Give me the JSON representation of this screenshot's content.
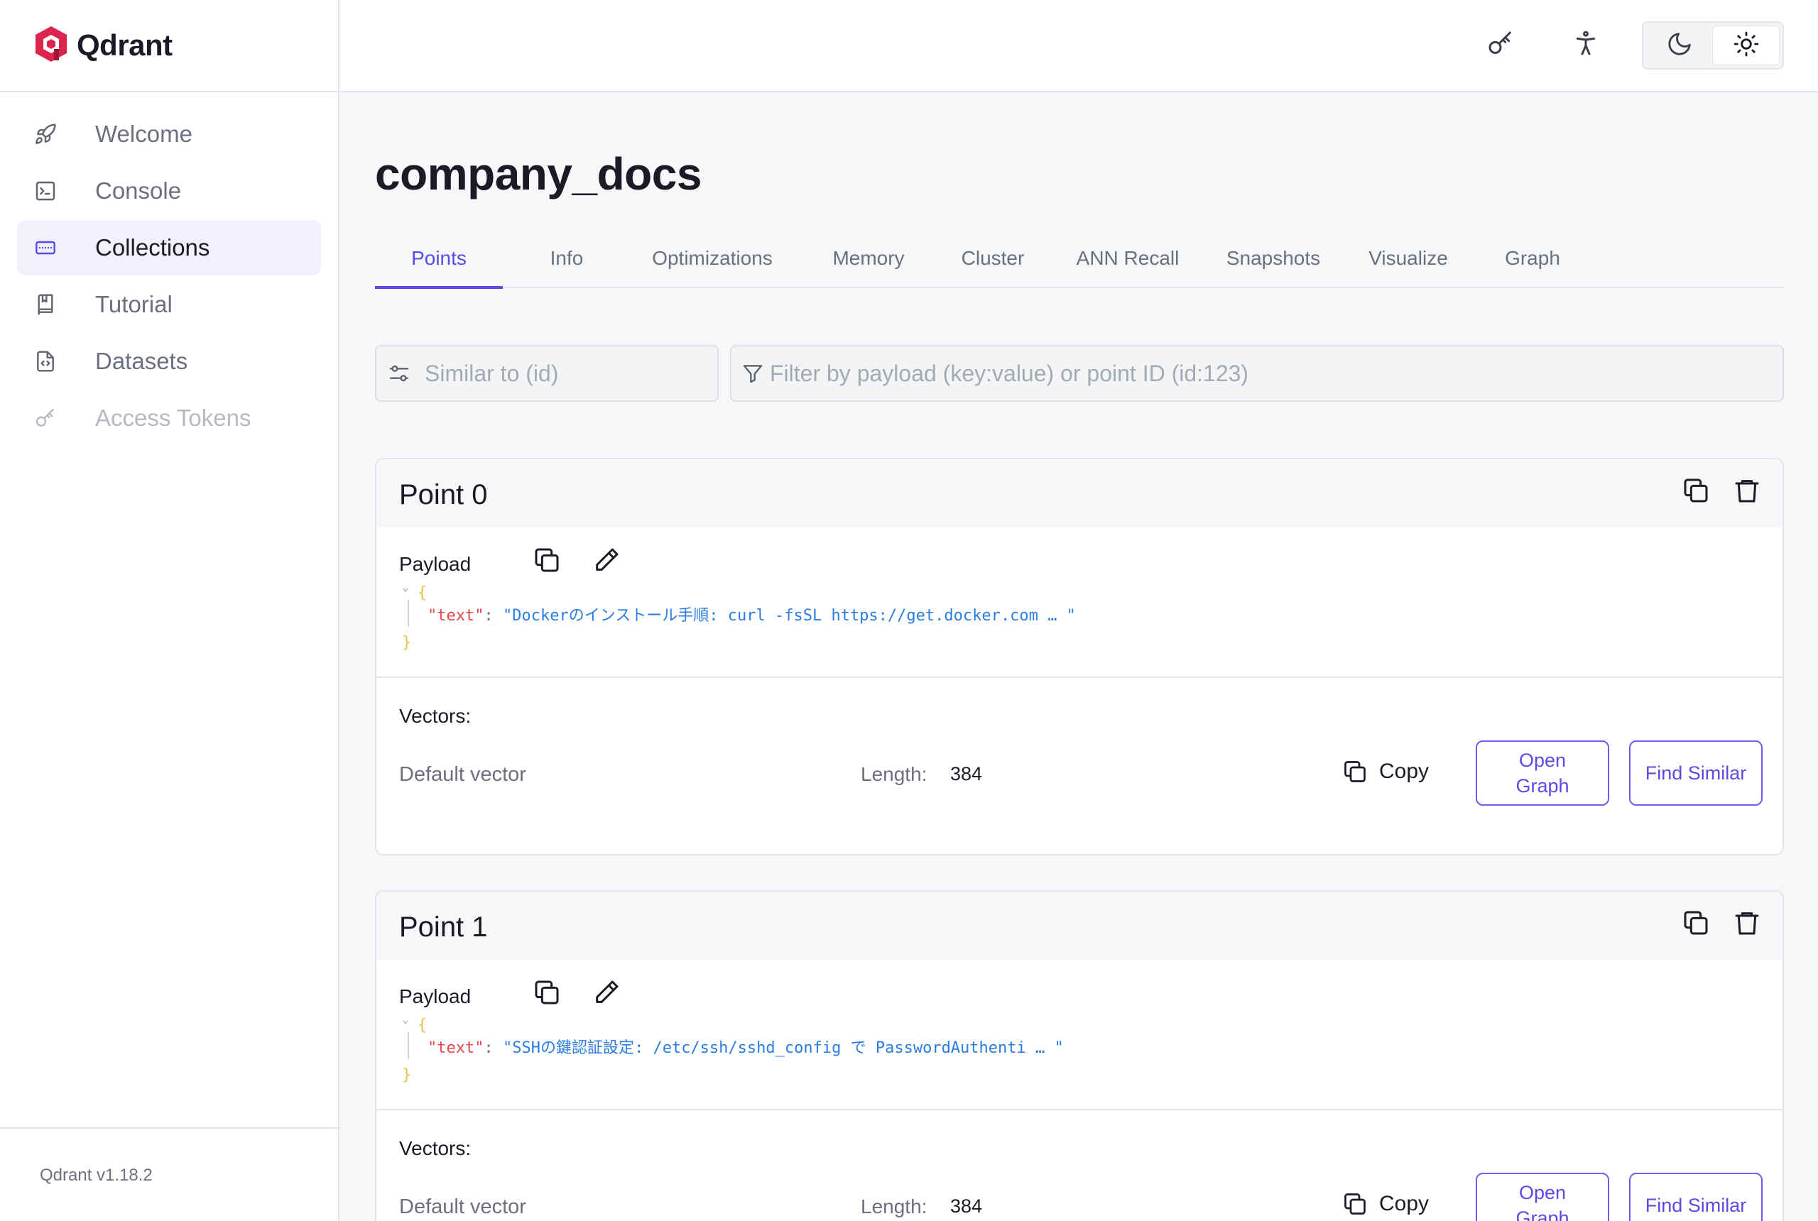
{
  "app": {
    "name": "Qdrant",
    "version": "Qdrant v1.18.2"
  },
  "sidebar": {
    "items": [
      {
        "label": "Welcome",
        "icon": "rocket-icon"
      },
      {
        "label": "Console",
        "icon": "terminal-icon"
      },
      {
        "label": "Collections",
        "icon": "collection-icon",
        "active": true
      },
      {
        "label": "Tutorial",
        "icon": "book-icon"
      },
      {
        "label": "Datasets",
        "icon": "file-code-icon"
      },
      {
        "label": "Access Tokens",
        "icon": "key-icon",
        "disabled": true
      }
    ]
  },
  "topbar": {
    "icons": [
      "key-icon",
      "accessibility-icon"
    ],
    "theme": {
      "options": [
        "moon-icon",
        "sun-icon"
      ],
      "selected": "light"
    }
  },
  "page": {
    "title": "company_docs"
  },
  "tabs": [
    "Points",
    "Info",
    "Optimizations",
    "Memory",
    "Cluster",
    "ANN Recall",
    "Snapshots",
    "Visualize",
    "Graph"
  ],
  "active_tab": "Points",
  "filters": {
    "similar_placeholder": "Similar to (id)",
    "filter_placeholder": "Filter by payload (key:value) or point ID (id:123)"
  },
  "labels": {
    "payload": "Payload",
    "vectors": "Vectors:",
    "default_vector": "Default vector",
    "length": "Length:",
    "copy": "Copy",
    "open_graph": "Open Graph",
    "find_similar": "Find Similar",
    "open_brace": "{",
    "close_brace": "}",
    "caret": "⌄",
    "colon": ":"
  },
  "points": [
    {
      "title": "Point 0",
      "payload_key": "\"text\"",
      "payload_value": "\"Dockerのインストール手順: curl -fsSL https://get.docker.com … \"",
      "vector_length": "384"
    },
    {
      "title": "Point 1",
      "payload_key": "\"text\"",
      "payload_value": "\"SSHの鍵認証設定: /etc/ssh/sshd_config で PasswordAuthenti … \"",
      "vector_length": "384"
    }
  ],
  "colors": {
    "accent": "#5b4ae3",
    "brand": "#dc244c",
    "json_key": "#e5484d",
    "json_string": "#2a7de1",
    "brace": "#e6c34a"
  }
}
